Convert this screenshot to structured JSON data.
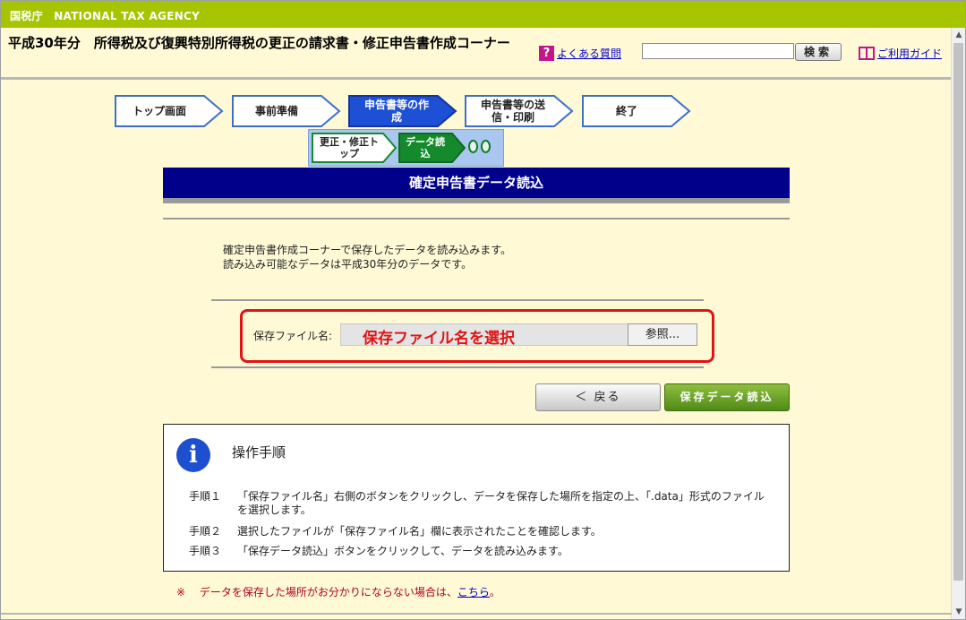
{
  "agency": {
    "name": "国税庁　NATIONAL TAX AGENCY"
  },
  "header": {
    "corner_title": "平成30年分　所得税及び復興特別所得税の更正の請求書・修正申告書作成コーナー",
    "faq_icon": "?",
    "faq_label": "よくある質問",
    "search_value": "",
    "search_button": "検索",
    "guide_label": "ご利用ガイド"
  },
  "steps": [
    {
      "label": "トップ画面",
      "state": "done"
    },
    {
      "label": "事前準備",
      "state": "done"
    },
    {
      "label": "申告書等の作成",
      "state": "active"
    },
    {
      "label": "申告書等の送信・印刷",
      "state": "todo"
    },
    {
      "label": "終了",
      "state": "todo"
    }
  ],
  "substeps": [
    {
      "label": "更正・修正トップ",
      "state": "done"
    },
    {
      "label": "データ読込",
      "state": "active"
    }
  ],
  "page": {
    "title": "確定申告書データ読込",
    "intro_line1": "確定申告書作成コーナーで保存したデータを読み込みます。",
    "intro_line2": "読み込み可能なデータは平成30年分のデータです。"
  },
  "file": {
    "label": "保存ファイル名:",
    "value": "",
    "browse_button": "参照...",
    "annotation": "保存ファイル名を選択"
  },
  "buttons": {
    "back": "＜ 戻る",
    "save_read": "保存データ読込"
  },
  "instructions": {
    "icon": "i",
    "title": "操作手順",
    "steps": [
      {
        "num": "手順１",
        "text": "「保存ファイル名」右側のボタンをクリックし、データを保存した場所を指定の上、「.data」形式のファイルを選択します。"
      },
      {
        "num": "手順２",
        "text": "選択したファイルが「保存ファイル名」欄に表示されたことを確認します。"
      },
      {
        "num": "手順３",
        "text": "「保存データ読込」ボタンをクリックして、データを読み込みます。"
      }
    ]
  },
  "note": {
    "mark": "※",
    "text": "データを保存した場所がお分かりにならない場合は、",
    "link": "こちら",
    "end": "。"
  },
  "colors": {
    "agency_bar": "#a6c400",
    "title_bar": "#00008b",
    "active_step": "#1e50d6",
    "active_substep": "#148a2c",
    "highlight": "#e01414"
  }
}
